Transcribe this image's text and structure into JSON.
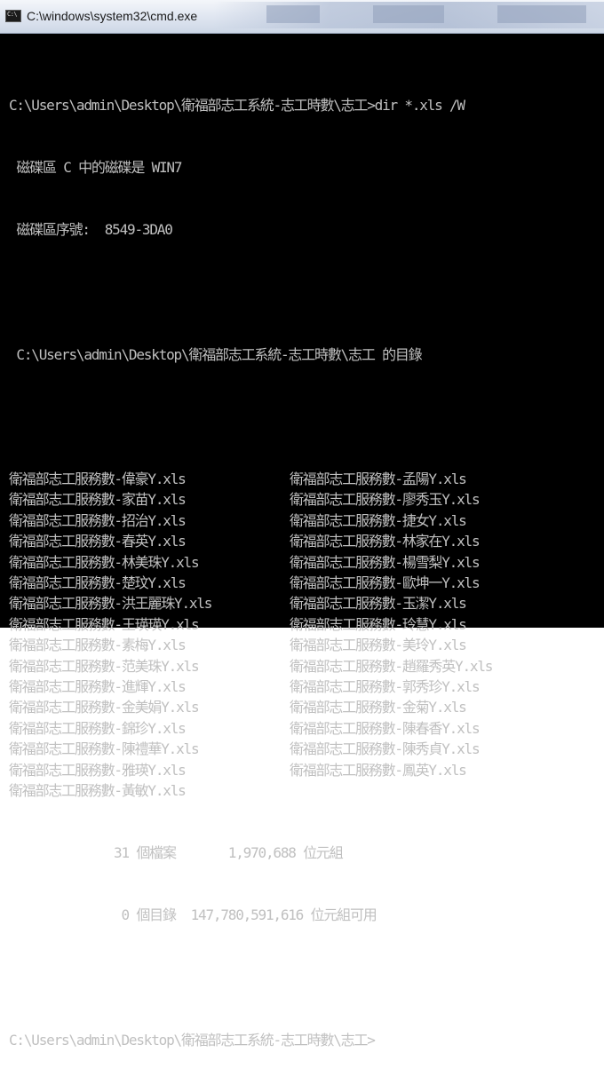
{
  "window": {
    "title": "C:\\windows\\system32\\cmd.exe",
    "icon_glyph": "C:\\"
  },
  "console": {
    "command_line": "C:\\Users\\admin\\Desktop\\衛福部志工系統-志工時數\\志工>dir *.xls /W",
    "volume_line": " 磁碟區 C 中的磁碟是 WIN7",
    "serial_line": " 磁碟區序號:  8549-3DA0",
    "dir_line": " C:\\Users\\admin\\Desktop\\衛福部志工系統-志工時數\\志工 的目錄",
    "file_rows": [
      [
        "衛福部志工服務數-偉豪Y.xls",
        "衛福部志工服務數-孟陽Y.xls"
      ],
      [
        "衛福部志工服務數-家苗Y.xls",
        "衛福部志工服務數-廖秀玉Y.xls"
      ],
      [
        "衛福部志工服務數-招治Y.xls",
        "衛福部志工服務數-捷女Y.xls"
      ],
      [
        "衛福部志工服務數-春英Y.xls",
        "衛福部志工服務數-林家在Y.xls"
      ],
      [
        "衛福部志工服務數-林美珠Y.xls",
        "衛福部志工服務數-楊雪梨Y.xls"
      ],
      [
        "衛福部志工服務數-楚玟Y.xls",
        "衛福部志工服務數-歐坤一Y.xls"
      ],
      [
        "衛福部志工服務數-洪王麗珠Y.xls",
        "衛福部志工服務數-玉潔Y.xls"
      ],
      [
        "衛福部志工服務數-王瑛瑛Y.xls",
        "衛福部志工服務數-玲慧Y.xls"
      ],
      [
        "衛福部志工服務數-素梅Y.xls",
        "衛福部志工服務數-美玲Y.xls"
      ],
      [
        "衛福部志工服務數-范美珠Y.xls",
        "衛福部志工服務數-趙羅秀英Y.xls"
      ],
      [
        "衛福部志工服務數-進輝Y.xls",
        "衛福部志工服務數-郭秀珍Y.xls"
      ],
      [
        "衛福部志工服務數-金美娟Y.xls",
        "衛福部志工服務數-金菊Y.xls"
      ],
      [
        "衛福部志工服務數-錦珍Y.xls",
        "衛福部志工服務數-陳春香Y.xls"
      ],
      [
        "衛福部志工服務數-陳禮華Y.xls",
        "衛福部志工服務數-陳秀貞Y.xls"
      ],
      [
        "衛福部志工服務數-雅瑛Y.xls",
        "衛福部志工服務數-鳳英Y.xls"
      ],
      [
        "衛福部志工服務數-黃敏Y.xls",
        ""
      ]
    ],
    "summary_files": "              31 個檔案       1,970,688 位元組",
    "summary_dirs": "               0 個目錄  147,780,591,616 位元組可用",
    "prompt_line": "C:\\Users\\admin\\Desktop\\衛福部志工系統-志工時數\\志工>"
  },
  "colors": {
    "console_bg": "#000000",
    "console_fg": "#c0c0c0"
  }
}
